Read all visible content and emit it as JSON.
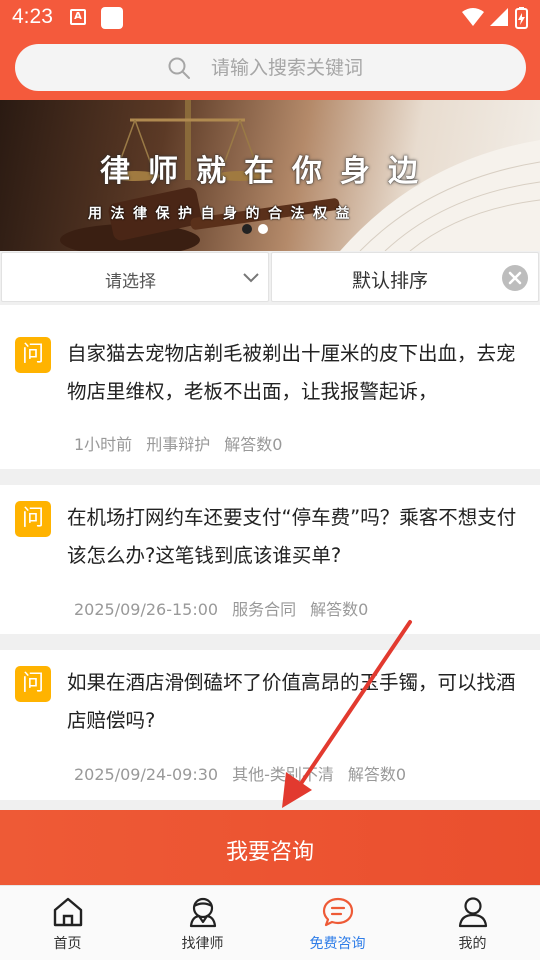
{
  "status_bar": {
    "time": "4:23",
    "a_badge": "A"
  },
  "search": {
    "placeholder": "请输入搜索关键词",
    "icon": "search-icon"
  },
  "banner": {
    "title": "律师就在你身边",
    "subtitle": "用法律保护自身的合法权益",
    "slide_count": 2,
    "active_slide": 1
  },
  "filters": {
    "category_label": "请选择",
    "sort_label": "默认排序"
  },
  "questions": [
    {
      "badge": "问",
      "text": "自家猫去宠物店剃毛被剃出十厘米的皮下出血，去宠物店里维权，老板不出面，让我报警起诉，",
      "time": "1小时前",
      "category": "刑事辩护",
      "answers": "解答数0"
    },
    {
      "badge": "问",
      "text": "在机场打网约车还要支付“停车费”吗？乘客不想支付该怎么办?这笔钱到底该谁买单?",
      "time": "2025/09/26-15:00",
      "category": "服务合同",
      "answers": "解答数0"
    },
    {
      "badge": "问",
      "text": "如果在酒店滑倒磕坏了价值高昂的玉手镯，可以找酒店赔偿吗?",
      "time": "2025/09/24-09:30",
      "category": "其他-类别不清",
      "answers": "解答数0"
    }
  ],
  "consult_button": "我要咨询",
  "tabs": [
    {
      "label": "首页",
      "icon": "home-icon"
    },
    {
      "label": "找律师",
      "icon": "lawyer-icon"
    },
    {
      "label": "免费咨询",
      "icon": "chat-icon",
      "active": true
    },
    {
      "label": "我的",
      "icon": "user-icon"
    }
  ],
  "colors": {
    "brand": "#f45a3c",
    "badge": "#ffb300",
    "active_tab": "#2f7de8",
    "arrow": "#e23a2f"
  }
}
